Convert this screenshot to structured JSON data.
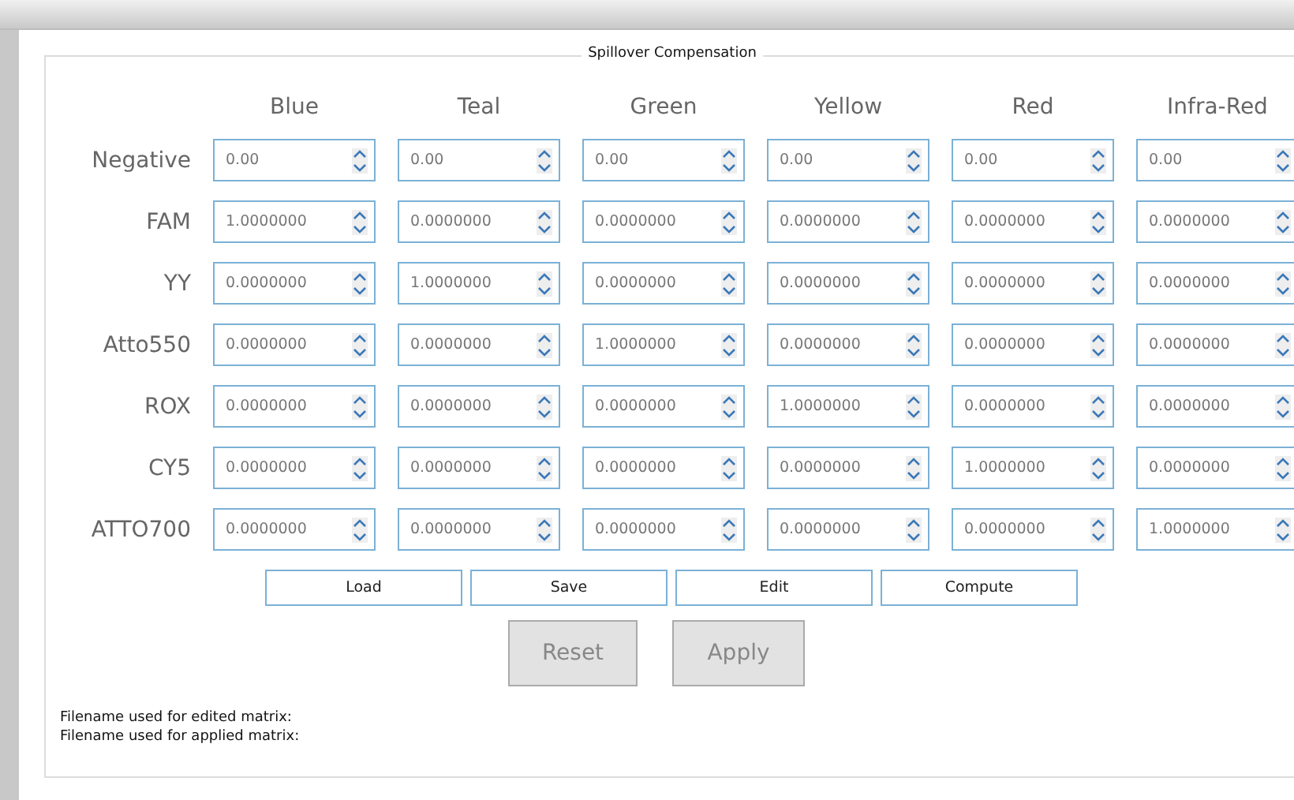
{
  "group_title": "Spillover Compensation",
  "columns": [
    "Blue",
    "Teal",
    "Green",
    "Yellow",
    "Red",
    "Infra-Red"
  ],
  "rows": [
    {
      "label": "Negative",
      "values": [
        "0.00",
        "0.00",
        "0.00",
        "0.00",
        "0.00",
        "0.00"
      ]
    },
    {
      "label": "FAM",
      "values": [
        "1.0000000",
        "0.0000000",
        "0.0000000",
        "0.0000000",
        "0.0000000",
        "0.0000000"
      ]
    },
    {
      "label": "YY",
      "values": [
        "0.0000000",
        "1.0000000",
        "0.0000000",
        "0.0000000",
        "0.0000000",
        "0.0000000"
      ]
    },
    {
      "label": "Atto550",
      "values": [
        "0.0000000",
        "0.0000000",
        "1.0000000",
        "0.0000000",
        "0.0000000",
        "0.0000000"
      ]
    },
    {
      "label": "ROX",
      "values": [
        "0.0000000",
        "0.0000000",
        "0.0000000",
        "1.0000000",
        "0.0000000",
        "0.0000000"
      ]
    },
    {
      "label": "CY5",
      "values": [
        "0.0000000",
        "0.0000000",
        "0.0000000",
        "0.0000000",
        "1.0000000",
        "0.0000000"
      ]
    },
    {
      "label": "ATTO700",
      "values": [
        "0.0000000",
        "0.0000000",
        "0.0000000",
        "0.0000000",
        "0.0000000",
        "1.0000000"
      ]
    }
  ],
  "matrix_buttons": [
    "Load",
    "Save",
    "Edit",
    "Compute"
  ],
  "action_buttons": [
    {
      "label": "Reset",
      "disabled": true
    },
    {
      "label": "Apply",
      "disabled": true
    }
  ],
  "file_lines": [
    "Filename used for edited matrix:",
    "Filename used for applied matrix:"
  ]
}
